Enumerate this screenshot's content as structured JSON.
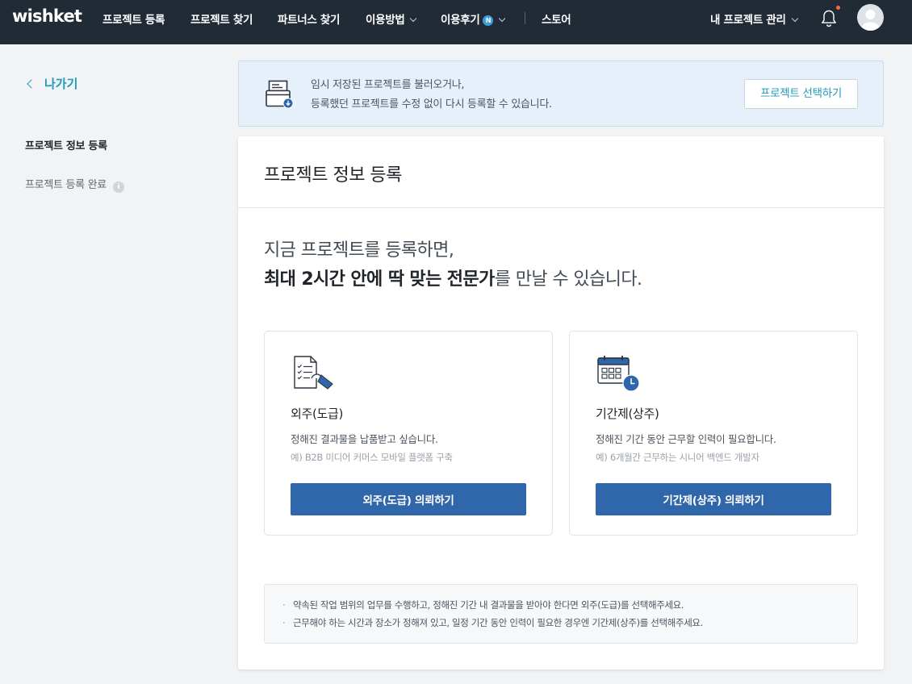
{
  "nav": {
    "logo": "wishket",
    "items": [
      {
        "label": "프로젝트 등록"
      },
      {
        "label": "프로젝트 찾기"
      },
      {
        "label": "파트너스 찾기"
      },
      {
        "label": "이용방법"
      },
      {
        "label": "이용후기",
        "badge": "N"
      },
      {
        "label": "스토어"
      }
    ],
    "my_projects": "내 프로젝트 관리"
  },
  "sidebar": {
    "back_label": "나가기",
    "steps": [
      {
        "label": "프로젝트 정보 등록",
        "state": "active"
      },
      {
        "label": "프로젝트 등록 완료",
        "state": "inactive"
      }
    ]
  },
  "banner": {
    "line1": "임시 저장된 프로젝트를 불러오거나,",
    "line2": "등록했던 프로젝트를 수정 없이 다시 등록할 수 있습니다.",
    "button": "프로젝트 선택하기"
  },
  "main": {
    "title": "프로젝트 정보 등록",
    "lead_line1": "지금 프로젝트를 등록하면,",
    "lead_line2_bold": "최대 2시간 안에 딱 맞는 전문가",
    "lead_line2_rest": "를 만날 수 있습니다.",
    "options": [
      {
        "title": "외주(도급)",
        "desc": "정해진 결과물을 납품받고 싶습니다.",
        "example": "예) B2B 미디어 커머스 모바일 플랫폼 구축",
        "button": "외주(도급) 의뢰하기",
        "icon": "checklist-document-icon"
      },
      {
        "title": "기간제(상주)",
        "desc": "정해진 기간 동안 근무할 인력이 필요합니다.",
        "example": "예) 6개월간 근무하는 시니어 백엔드 개발자",
        "button": "기간제(상주) 의뢰하기",
        "icon": "calendar-clock-icon"
      }
    ],
    "notes": [
      "약속된 작업 범위의 업무를 수행하고, 정해진 기간 내 결과물을 받아야 한다면 외주(도급)를 선택해주세요.",
      "근무해야 하는 시간과 장소가 정해져 있고, 일정 기간 동안 인력이 필요한 경우엔 기간제(상주)를 선택해주세요."
    ]
  },
  "colors": {
    "nav_bg": "#212b36",
    "accent": "#2099bb",
    "primary_button": "#2f67aa",
    "banner_bg": "#e6f0fa",
    "notification_dot": "#ff6b3a"
  }
}
